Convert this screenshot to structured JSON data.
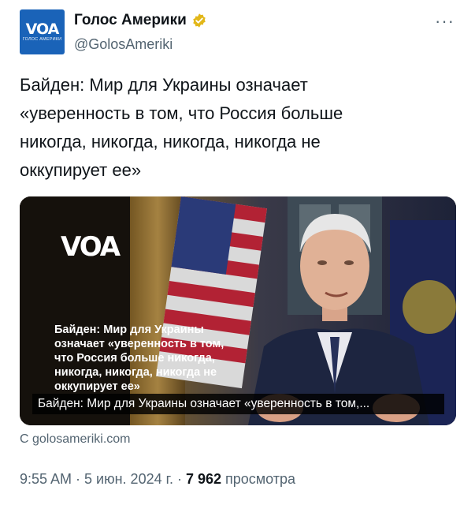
{
  "account": {
    "display_name": "Голос Америки",
    "handle": "@GolosAmeriki",
    "avatar_logo": "VOA",
    "avatar_sub": "ГОЛОС АМЕРИКИ",
    "verified_color": "#e2b719",
    "more_label": "···"
  },
  "tweet": {
    "text": "Байден: Мир для Украины означает «уверенность в том, что Россия больше никогда, никогда, никогда, никогда не оккупирует ее»"
  },
  "media": {
    "logo_text": "VOA",
    "headline": "Байден: Мир для Украины означает «уверенность в том, что Россия больше никогда, никогда, никогда, никогда не оккупирует ее»",
    "caption": "Байден: Мир для Украины означает «уверенность в том,..."
  },
  "card": {
    "source": "С golosameriki.com"
  },
  "meta": {
    "time": "9:55 AM",
    "separator": " · ",
    "date": "5 июн. 2024 г.",
    "views_count": "7 962",
    "views_label": " просмотра"
  },
  "colors": {
    "accent": "#1a63b8",
    "text": "#0f1419",
    "secondary": "#536471"
  }
}
